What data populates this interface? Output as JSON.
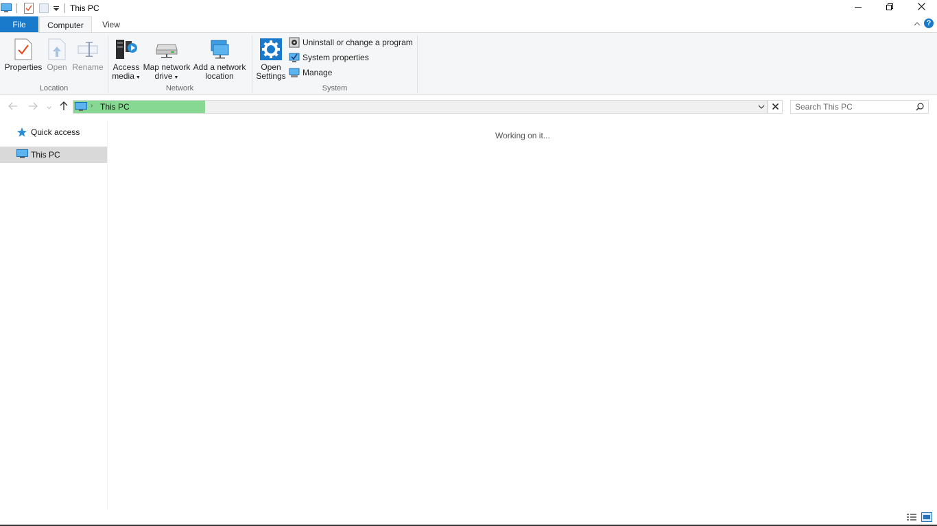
{
  "window": {
    "title": "This PC",
    "controls": [
      "minimize-icon",
      "restore-icon",
      "close-icon"
    ]
  },
  "tabs": {
    "file": "File",
    "computer": "Computer",
    "view": "View"
  },
  "ribbon": {
    "location": {
      "label": "Location",
      "properties": "Properties",
      "open": "Open",
      "rename": "Rename"
    },
    "network": {
      "label": "Network",
      "access_media_1": "Access",
      "access_media_2": "media",
      "map_drive_1": "Map network",
      "map_drive_2": "drive",
      "add_location_1": "Add a network",
      "add_location_2": "location"
    },
    "system": {
      "label": "System",
      "open_settings_1": "Open",
      "open_settings_2": "Settings",
      "uninstall": "Uninstall or change a program",
      "system_properties": "System properties",
      "manage": "Manage"
    }
  },
  "address": {
    "crumb": "This PC",
    "search_placeholder": "Search This PC"
  },
  "navpane": {
    "items": [
      {
        "label": "Quick access",
        "icon": "star-icon"
      },
      {
        "label": "This PC",
        "icon": "computer-icon",
        "selected": true
      }
    ]
  },
  "content": {
    "status": "Working on it..."
  },
  "colors": {
    "accent": "#1979ca",
    "address_highlight": "#86d892",
    "selection": "#d9d9d9"
  }
}
